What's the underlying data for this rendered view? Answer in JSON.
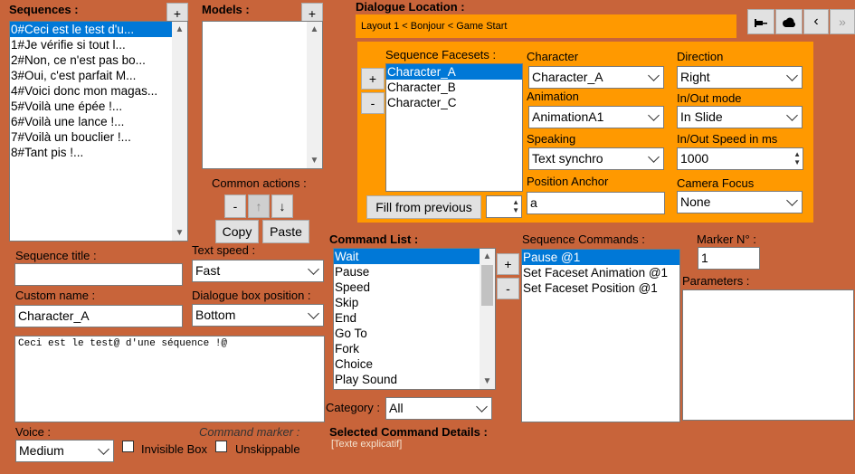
{
  "sequences": {
    "label": "Sequences :",
    "add_label": "+",
    "items": [
      "0#Ceci est le test d'u...",
      "1#Je vérifie si tout l...",
      "2#Non, ce n'est pas bo...",
      "3#Oui, c'est parfait M...",
      "4#Voici donc mon magas...",
      "5#Voilà une épée !...",
      "6#Voilà une lance !...",
      "7#Voilà un bouclier !...",
      "8#Tant pis !..."
    ]
  },
  "models": {
    "label": "Models :",
    "add_label": "+"
  },
  "common_actions": {
    "label": "Common actions :",
    "minus": "-",
    "up": "↑",
    "down": "↓",
    "copy": "Copy",
    "paste": "Paste"
  },
  "sequence_title": {
    "label": "Sequence title :",
    "value": ""
  },
  "custom_name": {
    "label": "Custom name :",
    "value": "Character_A"
  },
  "text_speed": {
    "label": "Text speed :",
    "value": "Fast"
  },
  "dialogue_box_position": {
    "label": "Dialogue box position :",
    "value": "Bottom"
  },
  "message_text": "Ceci est le test@ d'une séquence !@",
  "voice": {
    "label": "Voice :",
    "value": "Medium"
  },
  "invisible_box": "Invisible Box",
  "unskippable": "Unskippable",
  "command_marker": "Command marker :",
  "dialogue_location": {
    "label": "Dialogue Location :",
    "value": "Layout 1 < Bonjour < Game Start"
  },
  "top_buttons": [
    "pin-icon",
    "cloud-icon",
    "back-icon",
    "forward-icon"
  ],
  "facesets": {
    "label": "Sequence Facesets :",
    "add": "+",
    "remove": "-",
    "items": [
      "Character_A",
      "Character_B",
      "Character_C"
    ],
    "fill_button": "Fill from previous"
  },
  "character": {
    "label": "Character",
    "value": "Character_A"
  },
  "animation": {
    "label": "Animation",
    "value": "AnimationA1"
  },
  "speaking": {
    "label": "Speaking",
    "value": "Text synchro"
  },
  "position_anchor": {
    "label": "Position Anchor",
    "value": "a"
  },
  "direction": {
    "label": "Direction",
    "value": "Right"
  },
  "inout_mode": {
    "label": "In/Out mode",
    "value": "In Slide"
  },
  "inout_speed": {
    "label": "In/Out Speed in ms",
    "value": "1000"
  },
  "camera_focus": {
    "label": "Camera Focus",
    "value": "None"
  },
  "command_list": {
    "label": "Command List :",
    "items": [
      "Wait",
      "Pause",
      "Speed",
      "Skip",
      "End",
      "Go To",
      "Fork",
      "Choice",
      "Play Sound"
    ],
    "add": "+",
    "remove": "-"
  },
  "category": {
    "label": "Category :",
    "value": "All"
  },
  "selected_command": {
    "label": "Selected Command  Details :",
    "hint": "[Texte explicatif]"
  },
  "sequence_commands": {
    "label": "Sequence Commands :",
    "items": [
      "Pause @1",
      "Set Faceset Animation @1",
      "Set Faceset Position @1"
    ]
  },
  "marker": {
    "label": "Marker N° :",
    "value": "1"
  },
  "parameters": {
    "label": "Parameters :"
  },
  "colors": {
    "background": "#C8643A",
    "panel": "#FF9900",
    "selection": "#0078D7"
  }
}
